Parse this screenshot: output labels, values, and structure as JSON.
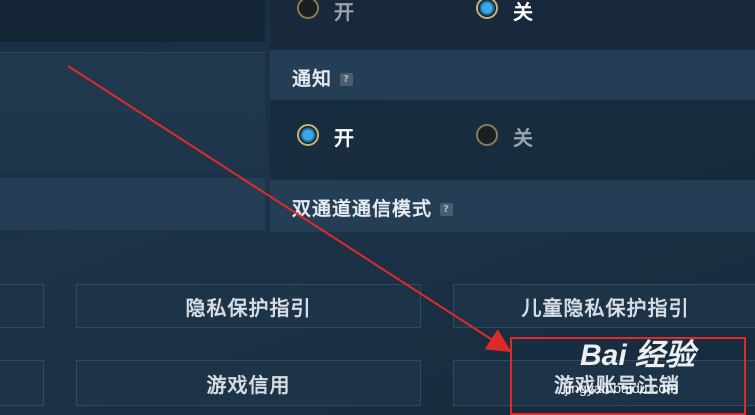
{
  "top_row": {
    "option_on": "开",
    "option_off": "关",
    "selected": "off"
  },
  "notification": {
    "title": "通知",
    "help": "?",
    "option_on": "开",
    "option_off": "关",
    "selected": "on"
  },
  "dual_channel": {
    "title": "双通道通信模式",
    "help": "?"
  },
  "buttons": {
    "privacy_guide": "隐私保护指引",
    "child_privacy_guide": "儿童隐私保护指引",
    "game_credit": "游戏信用",
    "highlighted_partial": "游戏账号注销"
  },
  "annotation": {
    "color": "#e02a2a"
  },
  "watermark": {
    "brand": "Bai 经验",
    "url": "jingyan.baidu.com"
  }
}
